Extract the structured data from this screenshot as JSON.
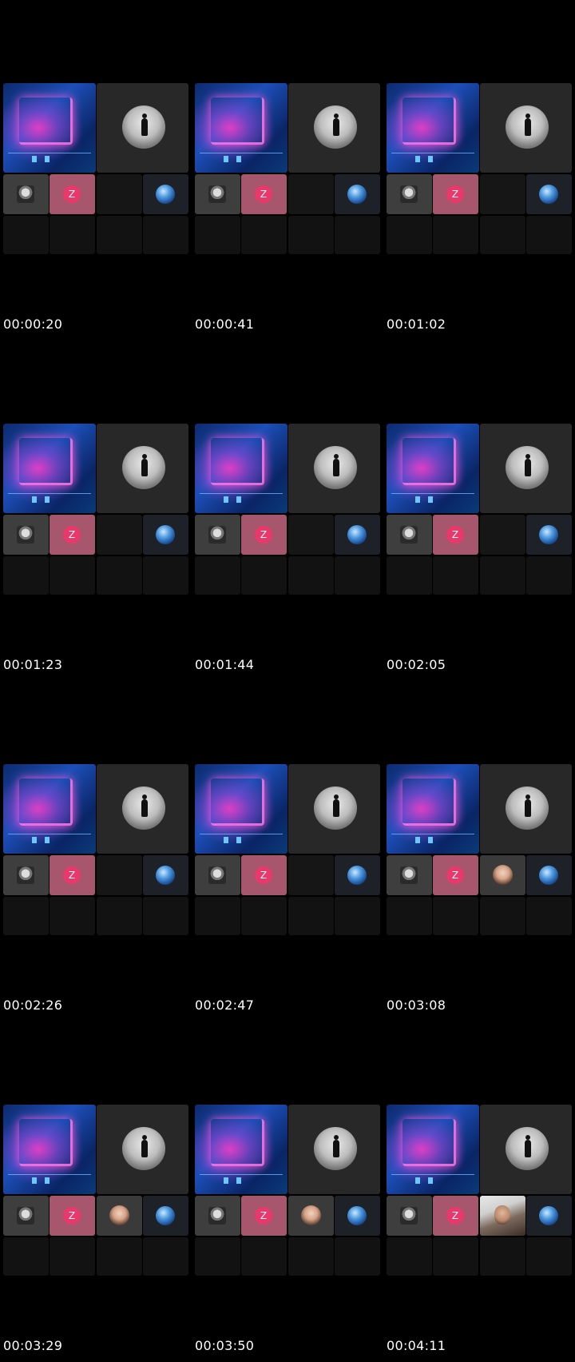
{
  "title": "",
  "frames": [
    {
      "timestamp": "00:00:20",
      "tile3": "empty"
    },
    {
      "timestamp": "00:00:41",
      "tile3": "empty"
    },
    {
      "timestamp": "00:01:02",
      "tile3": "empty"
    },
    {
      "timestamp": "00:01:23",
      "tile3": "empty"
    },
    {
      "timestamp": "00:01:44",
      "tile3": "empty"
    },
    {
      "timestamp": "00:02:05",
      "tile3": "empty"
    },
    {
      "timestamp": "00:02:26",
      "tile3": "empty"
    },
    {
      "timestamp": "00:02:47",
      "tile3": "empty"
    },
    {
      "timestamp": "00:03:08",
      "tile3": "guest-avatar"
    },
    {
      "timestamp": "00:03:29",
      "tile3": "guest-avatar"
    },
    {
      "timestamp": "00:03:50",
      "tile3": "guest-avatar"
    },
    {
      "timestamp": "00:04:11",
      "tile3": "guest-video"
    }
  ],
  "tiles": {
    "shared_screen_icon": "screen-share-thumbnail",
    "host_avatar_icon": "snow-person-avatar-icon",
    "participant1_icon": "portrait-avatar-icon",
    "participant2_initial": "Z",
    "participant4_icon": "earth-avatar-icon"
  },
  "colors": {
    "background": "#000000",
    "tile": "#282828",
    "z_badge": "#e9386b",
    "z_tile": "#a6576d"
  }
}
